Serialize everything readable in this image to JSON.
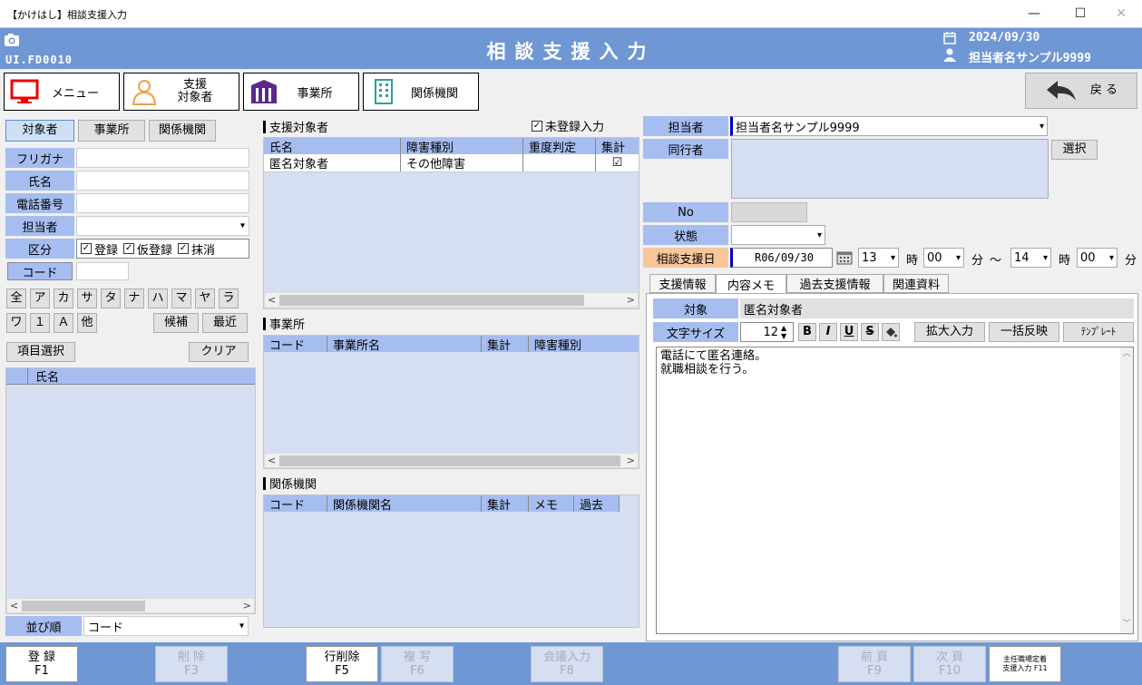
{
  "window": {
    "title": "【かけはし】相談支援入力",
    "minimize": "—",
    "maximize": "☐",
    "close": "✕"
  },
  "header": {
    "title": "相談支援入力",
    "screen_id": "UI.FD0010",
    "date": "2024/09/30",
    "user": "担当者名サンプル9999"
  },
  "nav": {
    "menu": "メニュー",
    "client_l1": "支援",
    "client_l2": "対象者",
    "office": "事業所",
    "agency": "関係機関",
    "back": "戻 る"
  },
  "search": {
    "tabs": [
      "対象者",
      "事業所",
      "関係機関"
    ],
    "furigana": "フリガナ",
    "name": "氏名",
    "phone": "電話番号",
    "staff": "担当者",
    "category": "区分",
    "chk_registered": "登録",
    "chk_temp": "仮登録",
    "chk_deleted": "抹消",
    "code": "コード",
    "kana_row1": [
      "全",
      "ア",
      "カ",
      "サ",
      "タ",
      "ナ",
      "ハ",
      "マ",
      "ヤ",
      "ラ"
    ],
    "kana_row2": [
      "ワ",
      "１",
      "Ａ",
      "他"
    ],
    "candidate": "候補",
    "recent": "最近",
    "item_select": "項目選択",
    "clear": "クリア",
    "result_header": "氏名",
    "sort_label": "並び順",
    "sort_value": "コード"
  },
  "clients": {
    "section": "支援対象者",
    "unregistered": "未登録入力",
    "columns": [
      "氏名",
      "障害種別",
      "重度判定",
      "集計"
    ],
    "rows": [
      {
        "name": "匿名対象者",
        "type": "その他障害",
        "severity": "",
        "sum": "☑"
      }
    ]
  },
  "offices": {
    "section": "事業所",
    "columns": [
      "コード",
      "事業所名",
      "集計",
      "障害種別"
    ]
  },
  "agencies": {
    "section": "関係機関",
    "columns": [
      "コード",
      "関係機関名",
      "集計",
      "メモ",
      "過去"
    ]
  },
  "detail": {
    "staff_label": "担当者",
    "staff_value": "担当者名サンプル9999",
    "companion_label": "同行者",
    "select_btn": "選択",
    "no_label": "No",
    "status_label": "状態",
    "date_label": "相談支援日",
    "date_value": "R06/09/30",
    "start_hour": "13",
    "hour_unit": "時",
    "start_min": "00",
    "min_unit": "分",
    "tilde": "～",
    "end_hour": "14",
    "end_min": "00"
  },
  "tabs": [
    "支援情報",
    "内容メモ",
    "過去支援情報",
    "関連資料"
  ],
  "memo": {
    "target_label": "対象",
    "target_value": "匿名対象者",
    "fontsize_label": "文字サイズ",
    "fontsize_value": "12",
    "bold": "B",
    "italic": "I",
    "underline": "U",
    "strike": "S",
    "expand": "拡大入力",
    "bulk": "一括反映",
    "template": "ﾃﾝﾌﾟﾚｰﾄ",
    "line1": "電話にて匿名連絡。",
    "line2": "就職相談を行う。"
  },
  "fkeys": [
    {
      "l1": "登 録",
      "l2": "F1"
    },
    {
      "l1": "削 除",
      "l2": "F3"
    },
    {
      "l1": "行削除",
      "l2": "F5"
    },
    {
      "l1": "複 写",
      "l2": "F6"
    },
    {
      "l1": "会議入力",
      "l2": "F8"
    },
    {
      "l1": "前 頁",
      "l2": "F9"
    },
    {
      "l1": "次 頁",
      "l2": "F10"
    },
    {
      "l1": "主任職場定着",
      "l2": "支援入力 F11"
    }
  ],
  "colors": {
    "header": "#6f97d4",
    "label": "#a6bdf0",
    "panel": "#d5dff1",
    "date_label": "#f7c79b"
  }
}
